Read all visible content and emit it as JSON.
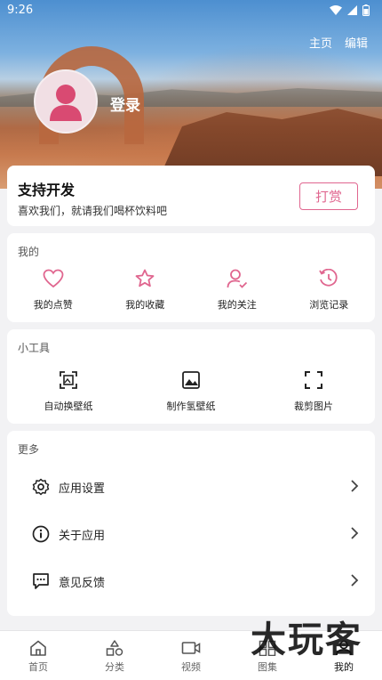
{
  "status": {
    "time": "9:26"
  },
  "header": {
    "home_link": "主页",
    "edit_link": "编辑",
    "login": "登录"
  },
  "support": {
    "title": "支持开发",
    "subtitle": "喜欢我们，就请我们喝杯饮料吧",
    "reward_button": "打赏"
  },
  "mine": {
    "label": "我的",
    "items": [
      {
        "label": "我的点赞",
        "icon": "heart-icon"
      },
      {
        "label": "我的收藏",
        "icon": "star-icon"
      },
      {
        "label": "我的关注",
        "icon": "user-check-icon"
      },
      {
        "label": "浏览记录",
        "icon": "history-icon"
      }
    ]
  },
  "tools": {
    "label": "小工具",
    "items": [
      {
        "label": "自动换壁纸",
        "icon": "auto-wallpaper-icon"
      },
      {
        "label": "制作氢壁纸",
        "icon": "image-icon"
      },
      {
        "label": "裁剪图片",
        "icon": "crop-icon"
      }
    ]
  },
  "more": {
    "label": "更多",
    "items": [
      {
        "label": "应用设置",
        "icon": "gear-icon"
      },
      {
        "label": "关于应用",
        "icon": "info-icon"
      },
      {
        "label": "意见反馈",
        "icon": "feedback-icon"
      }
    ]
  },
  "tabs": [
    {
      "label": "首页",
      "icon": "home-icon"
    },
    {
      "label": "分类",
      "icon": "category-icon"
    },
    {
      "label": "视频",
      "icon": "video-icon"
    },
    {
      "label": "图集",
      "icon": "gallery-icon"
    },
    {
      "label": "我的",
      "icon": "profile-icon",
      "active": true
    }
  ],
  "watermark": "大玩客",
  "colors": {
    "accent": "#e0668f",
    "background": "#f2f2f4"
  }
}
